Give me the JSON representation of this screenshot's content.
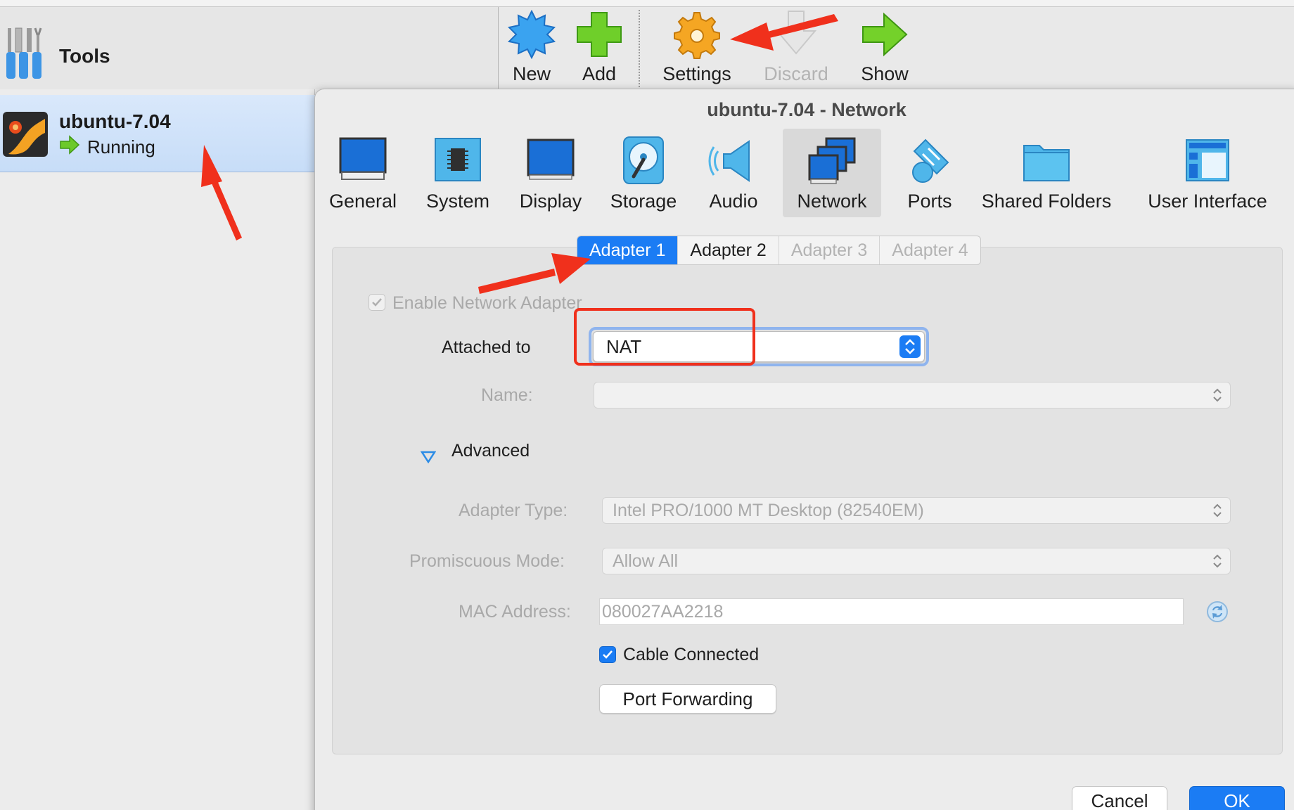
{
  "manager": {
    "tools_label": "Tools",
    "toolbar": {
      "new_label": "New",
      "add_label": "Add",
      "settings_label": "Settings",
      "discard_label": "Discard",
      "show_label": "Show"
    },
    "vm": {
      "name": "ubuntu-7.04",
      "status": "Running"
    }
  },
  "dialog": {
    "title": "ubuntu-7.04 - Network",
    "categories": [
      {
        "label": "General",
        "icon": "general-icon"
      },
      {
        "label": "System",
        "icon": "system-chip-icon"
      },
      {
        "label": "Display",
        "icon": "display-monitor-icon"
      },
      {
        "label": "Storage",
        "icon": "storage-disk-icon"
      },
      {
        "label": "Audio",
        "icon": "audio-speaker-icon"
      },
      {
        "label": "Network",
        "icon": "network-icon",
        "active": true
      },
      {
        "label": "Ports",
        "icon": "ports-plug-icon"
      },
      {
        "label": "Shared Folders",
        "icon": "shared-folder-icon"
      },
      {
        "label": "User Interface",
        "icon": "user-interface-icon"
      }
    ],
    "adapter_tabs": [
      "Adapter 1",
      "Adapter 2",
      "Adapter 3",
      "Adapter 4"
    ],
    "enable_adapter_label": "Enable Network Adapter",
    "attached_to_label": "Attached to",
    "attached_to_value": "NAT",
    "name_label": "Name:",
    "name_value": "",
    "advanced_label": "Advanced",
    "adapter_type_label": "Adapter Type:",
    "adapter_type_value": "Intel PRO/1000 MT Desktop (82540EM)",
    "promiscuous_label": "Promiscuous Mode:",
    "promiscuous_value": "Allow All",
    "mac_label": "MAC Address:",
    "mac_value": "080027AA2218",
    "cable_label": "Cable Connected",
    "port_forwarding_label": "Port Forwarding",
    "cancel_label": "Cancel",
    "ok_label": "OK"
  },
  "colors": {
    "accent": "#1b7cf4",
    "annotation": "#f0301c"
  }
}
